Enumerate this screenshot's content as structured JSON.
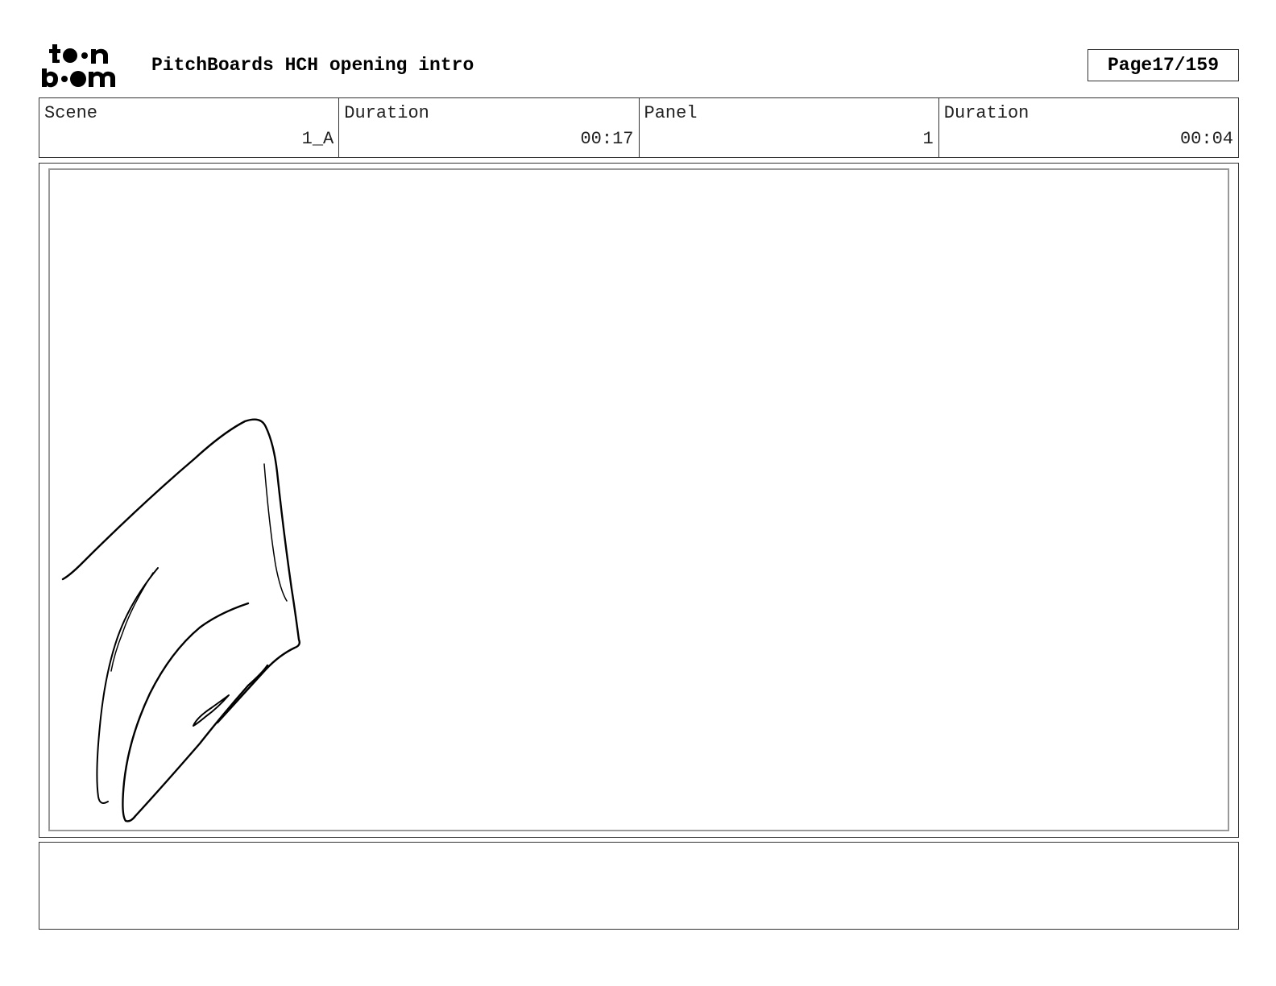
{
  "header": {
    "logo": {
      "icon": "toonboom-logo-icon",
      "line1": "toon",
      "line2": "boom"
    },
    "title": "PitchBoards HCH opening intro",
    "page_label": "Page",
    "page_value": "17/159"
  },
  "info": {
    "scene_label": "Scene",
    "scene_value": "1_A",
    "scene_duration_label": "Duration",
    "scene_duration_value": "00:17",
    "panel_label": "Panel",
    "panel_value": "1",
    "panel_duration_label": "Duration",
    "panel_duration_value": "00:04"
  },
  "panel": {
    "sketch": "sketch-drawing"
  },
  "notes": {
    "text": ""
  }
}
